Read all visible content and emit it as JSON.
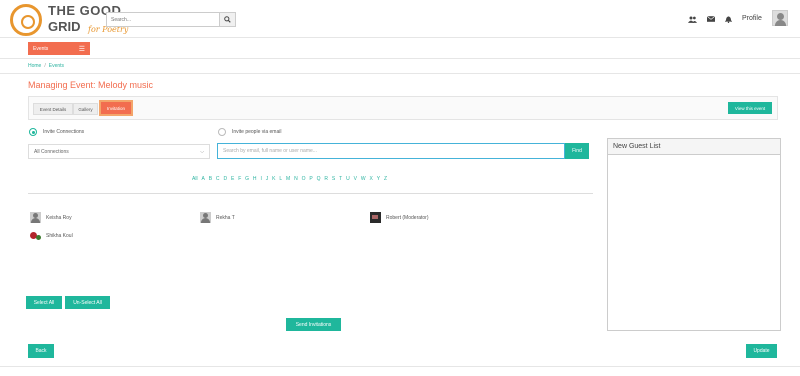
{
  "header": {
    "logo_line1": "THE GOOD",
    "logo_line2": "GRID",
    "logo_sub": "for Poetry",
    "search_placeholder": "Search...",
    "profile_label": "Profile"
  },
  "nav": {
    "events_label": "Events"
  },
  "breadcrumb": {
    "items": [
      "Home",
      "Events"
    ],
    "separator": "/"
  },
  "page": {
    "title": "Managing Event: Melody music"
  },
  "tabs": [
    {
      "label": "Event Details"
    },
    {
      "label": "Gallery"
    },
    {
      "label": "Invitation"
    }
  ],
  "view_event_label": "View this event",
  "invite": {
    "option_connections": "Invite Connections",
    "option_email": "Invite people via email",
    "select_value": "All Connections",
    "find_placeholder": "Search by email, full name or user name...",
    "find_label": "Find"
  },
  "alphabet": [
    "All",
    "A",
    "B",
    "C",
    "D",
    "E",
    "F",
    "G",
    "H",
    "I",
    "J",
    "K",
    "L",
    "M",
    "N",
    "O",
    "P",
    "Q",
    "R",
    "S",
    "T",
    "U",
    "V",
    "W",
    "X",
    "Y",
    "Z"
  ],
  "guests": [
    {
      "name": "Keisha Roy",
      "avatar": "person-icon"
    },
    {
      "name": "Rekha T",
      "avatar": "person-icon"
    },
    {
      "name": "Robert (Moderator)",
      "avatar": "photo-icon"
    },
    {
      "name": "Shikha Koul",
      "avatar": "flower-icon"
    }
  ],
  "actions": {
    "select_all": "Select All",
    "unselect_all": "Un-Select All",
    "send_invitations": "Send Invitations",
    "back": "Back",
    "update": "Update"
  },
  "guest_list": {
    "title": "New Guest List"
  },
  "colors": {
    "accent": "#f26d4f",
    "teal": "#1fb79c",
    "logo_orange": "#e8962e"
  }
}
